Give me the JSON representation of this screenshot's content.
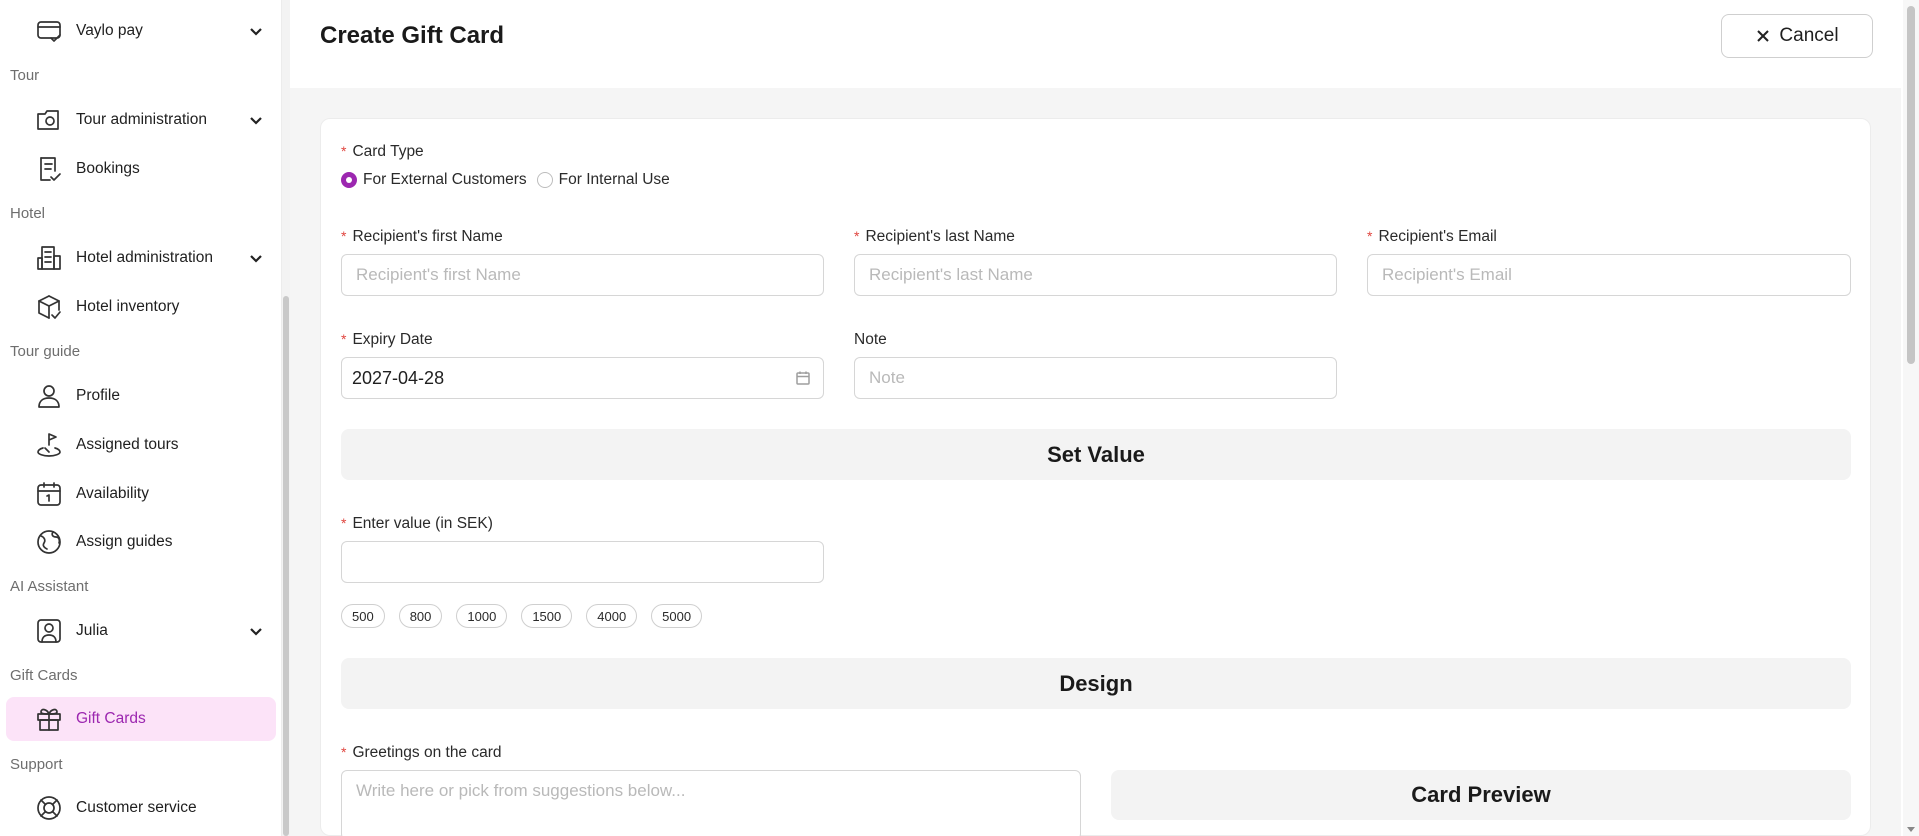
{
  "sidebar": {
    "sections": [
      {
        "label": "Tour"
      },
      {
        "label": "Hotel"
      },
      {
        "label": "Tour guide"
      },
      {
        "label": "AI Assistant"
      },
      {
        "label": "Gift Cards"
      },
      {
        "label": "Support"
      }
    ],
    "items": [
      {
        "label": "Vaylo pay",
        "icon": "card-check-icon",
        "expandable": true
      },
      {
        "label": "Tour administration",
        "icon": "camera-folder-icon",
        "expandable": true
      },
      {
        "label": "Bookings",
        "icon": "document-check-icon",
        "expandable": false
      },
      {
        "label": "Hotel administration",
        "icon": "building-icon",
        "expandable": true
      },
      {
        "label": "Hotel inventory",
        "icon": "box-check-icon",
        "expandable": false
      },
      {
        "label": "Profile",
        "icon": "user-icon",
        "expandable": false
      },
      {
        "label": "Assigned tours",
        "icon": "route-flag-icon",
        "expandable": false
      },
      {
        "label": "Availability",
        "icon": "calendar-icon",
        "expandable": false
      },
      {
        "label": "Assign guides",
        "icon": "globe-pin-icon",
        "expandable": false
      },
      {
        "label": "Julia",
        "icon": "user-square-icon",
        "expandable": true
      },
      {
        "label": "Gift Cards",
        "icon": "gift-icon",
        "expandable": false,
        "active": true
      },
      {
        "label": "Customer service",
        "icon": "lifebuoy-icon",
        "expandable": false
      }
    ]
  },
  "header": {
    "title": "Create Gift Card",
    "cancel_label": "Cancel"
  },
  "form": {
    "card_type": {
      "label": "Card Type",
      "options": [
        "For External Customers",
        "For Internal Use"
      ],
      "selected": "For External Customers"
    },
    "first_name": {
      "label": "Recipient's first Name",
      "placeholder": "Recipient's first Name",
      "value": ""
    },
    "last_name": {
      "label": "Recipient's last Name",
      "placeholder": "Recipient's last Name",
      "value": ""
    },
    "email": {
      "label": "Recipient's Email",
      "placeholder": "Recipient's Email",
      "value": ""
    },
    "expiry": {
      "label": "Expiry Date",
      "value": "2027-04-28"
    },
    "note": {
      "label": "Note",
      "placeholder": "Note",
      "value": ""
    },
    "set_value_title": "Set Value",
    "value": {
      "label": "Enter value (in SEK)",
      "value": ""
    },
    "value_chips": [
      "500",
      "800",
      "1000",
      "1500",
      "4000",
      "5000"
    ],
    "design_title": "Design",
    "greetings": {
      "label": "Greetings on the card",
      "placeholder": "Write here or pick from suggestions below..."
    },
    "preview_title": "Card Preview"
  },
  "colors": {
    "accent": "#9c27b0",
    "active_bg": "#fce3f8",
    "required": "#e0443e"
  }
}
